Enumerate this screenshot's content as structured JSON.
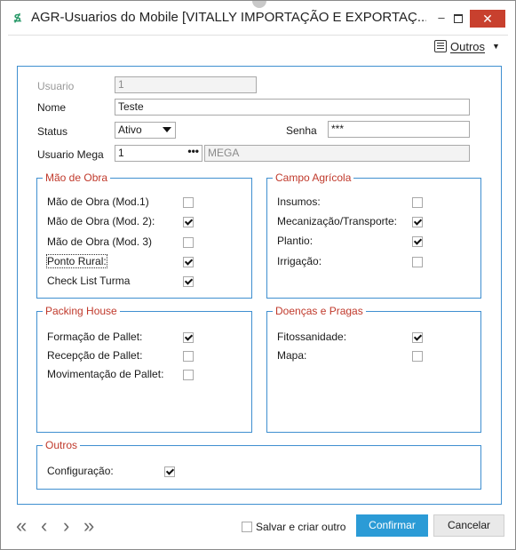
{
  "window": {
    "title": "AGR-Usuarios do Mobile [VITALLY IMPORTAÇÃO E EXPORTAÇ...",
    "minimize": "–",
    "close": "✕"
  },
  "toolbar": {
    "outros_label": "Outros"
  },
  "form": {
    "usuario_label": "Usuario",
    "usuario_value": "1",
    "nome_label": "Nome",
    "nome_value": "Teste",
    "status_label": "Status",
    "status_value": "Ativo",
    "senha_label": "Senha",
    "senha_value": "***",
    "usuario_mega_label": "Usuario Mega",
    "usuario_mega_value": "1",
    "usuario_mega_browse": "•••",
    "usuario_mega_name": "MEGA"
  },
  "groups": {
    "mao_de_obra": {
      "title": "Mão de Obra",
      "items": [
        {
          "label": "Mão de Obra (Mod.1)",
          "checked": false
        },
        {
          "label": "Mão de Obra (Mod. 2):",
          "checked": true
        },
        {
          "label": "Mão de Obra (Mod. 3)",
          "checked": false
        },
        {
          "label": "Ponto Rural:",
          "checked": true
        },
        {
          "label": "Check List Turma",
          "checked": true
        }
      ]
    },
    "campo_agricola": {
      "title": "Campo Agrícola",
      "items": [
        {
          "label": "Insumos:",
          "checked": false
        },
        {
          "label": "Mecanização/Transporte:",
          "checked": true
        },
        {
          "label": "Plantio:",
          "checked": true
        },
        {
          "label": "Irrigação:",
          "checked": false
        }
      ]
    },
    "packing_house": {
      "title": "Packing House",
      "items": [
        {
          "label": "Formação de Pallet:",
          "checked": true
        },
        {
          "label": "Recepção de Pallet:",
          "checked": false
        },
        {
          "label": "Movimentação de Pallet:",
          "checked": false
        }
      ]
    },
    "doencas_pragas": {
      "title": "Doenças e Pragas",
      "items": [
        {
          "label": "Fitossanidade:",
          "checked": true
        },
        {
          "label": "Mapa:",
          "checked": false
        }
      ]
    },
    "outros": {
      "title": "Outros",
      "items": [
        {
          "label": "Configuração:",
          "checked": true
        }
      ]
    }
  },
  "footer": {
    "save_and_new_label": "Salvar e criar outro",
    "confirm_label": "Confirmar",
    "cancel_label": "Cancelar",
    "nav_first": "«",
    "nav_prev": "‹",
    "nav_next": "›",
    "nav_last": "»"
  }
}
